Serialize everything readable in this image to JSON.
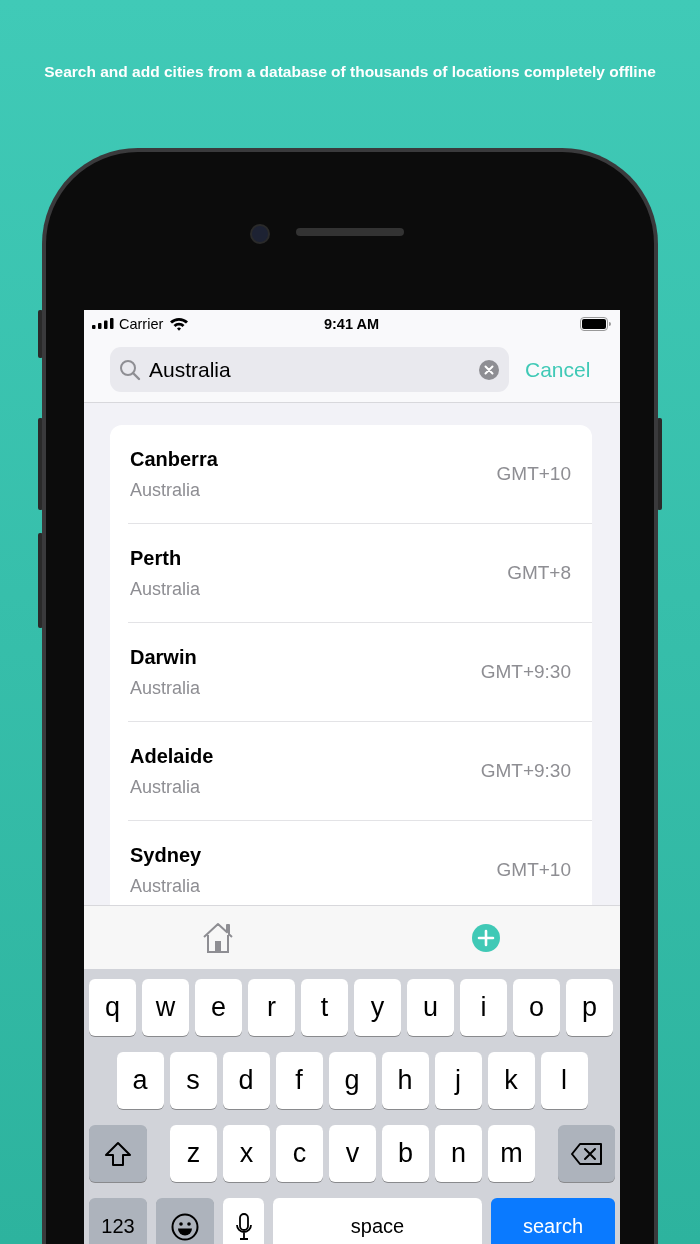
{
  "caption": "Search and add cities from a database of thousands of locations completely offline",
  "status_bar": {
    "carrier": "Carrier",
    "time": "9:41 AM"
  },
  "search": {
    "value": "Australia",
    "cancel": "Cancel"
  },
  "results": [
    {
      "city": "Canberra",
      "country": "Australia",
      "offset": "GMT+10"
    },
    {
      "city": "Perth",
      "country": "Australia",
      "offset": "GMT+8"
    },
    {
      "city": "Darwin",
      "country": "Australia",
      "offset": "GMT+9:30"
    },
    {
      "city": "Adelaide",
      "country": "Australia",
      "offset": "GMT+9:30"
    },
    {
      "city": "Sydney",
      "country": "Australia",
      "offset": "GMT+10"
    }
  ],
  "tab_bar": [
    {
      "kind": "home"
    },
    {
      "kind": "add"
    }
  ],
  "keyboard": {
    "letter_rows": [
      [
        "q",
        "w",
        "e",
        "r",
        "t",
        "y",
        "u",
        "i",
        "o",
        "p"
      ],
      [
        "a",
        "s",
        "d",
        "f",
        "g",
        "h",
        "j",
        "k",
        "l"
      ],
      [
        "z",
        "x",
        "c",
        "v",
        "b",
        "n",
        "m"
      ]
    ],
    "bottom_row": {
      "numbers_key": "123",
      "space_key": "space",
      "search_key": "search"
    }
  }
}
